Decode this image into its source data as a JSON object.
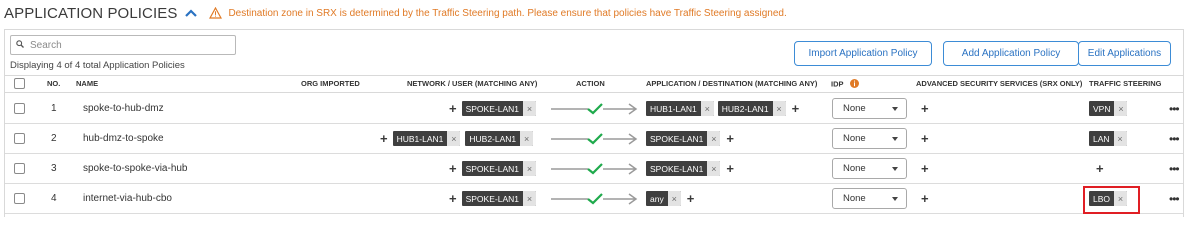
{
  "header": {
    "title": "APPLICATION POLICIES",
    "warning": "Destination zone in SRX is determined by the Traffic Steering path. Please ensure that policies have Traffic Steering assigned."
  },
  "search": {
    "placeholder": "Search",
    "value": ""
  },
  "displaying": "Displaying 4 of 4 total Application Policies",
  "buttons": {
    "import": "Import Application Policy",
    "add": "Add Application Policy",
    "edit": "Edit Applications"
  },
  "columns": {
    "no": "NO.",
    "name": "NAME",
    "org_imported": "ORG IMPORTED",
    "network_user": "NETWORK / USER (MATCHING ANY)",
    "action": "ACTION",
    "app_dest": "APPLICATION / DESTINATION (MATCHING ANY)",
    "idp": "IDP",
    "advanced_security": "ADVANCED SECURITY SERVICES (SRX ONLY)",
    "traffic_steering": "TRAFFIC STEERING"
  },
  "rows": [
    {
      "no": "1",
      "name": "spoke-to-hub-dmz",
      "network": [
        "SPOKE-LAN1"
      ],
      "destination": [
        "HUB1-LAN1",
        "HUB2-LAN1"
      ],
      "idp": "None",
      "steering": "VPN"
    },
    {
      "no": "2",
      "name": "hub-dmz-to-spoke",
      "network": [
        "HUB1-LAN1",
        "HUB2-LAN1"
      ],
      "destination": [
        "SPOKE-LAN1"
      ],
      "idp": "None",
      "steering": "LAN"
    },
    {
      "no": "3",
      "name": "spoke-to-spoke-via-hub",
      "network": [
        "SPOKE-LAN1"
      ],
      "destination": [
        "SPOKE-LAN1"
      ],
      "idp": "None",
      "steering": ""
    },
    {
      "no": "4",
      "name": "internet-via-hub-cbo",
      "network": [
        "SPOKE-LAN1"
      ],
      "destination": [
        "any"
      ],
      "idp": "None",
      "steering": "LBO"
    }
  ],
  "colors": {
    "accent": "#2a72c2",
    "warning": "#e07a26",
    "allow_check": "#1faa4c",
    "highlight": "#e01e24",
    "tag_bg": "#3f3f3f"
  }
}
